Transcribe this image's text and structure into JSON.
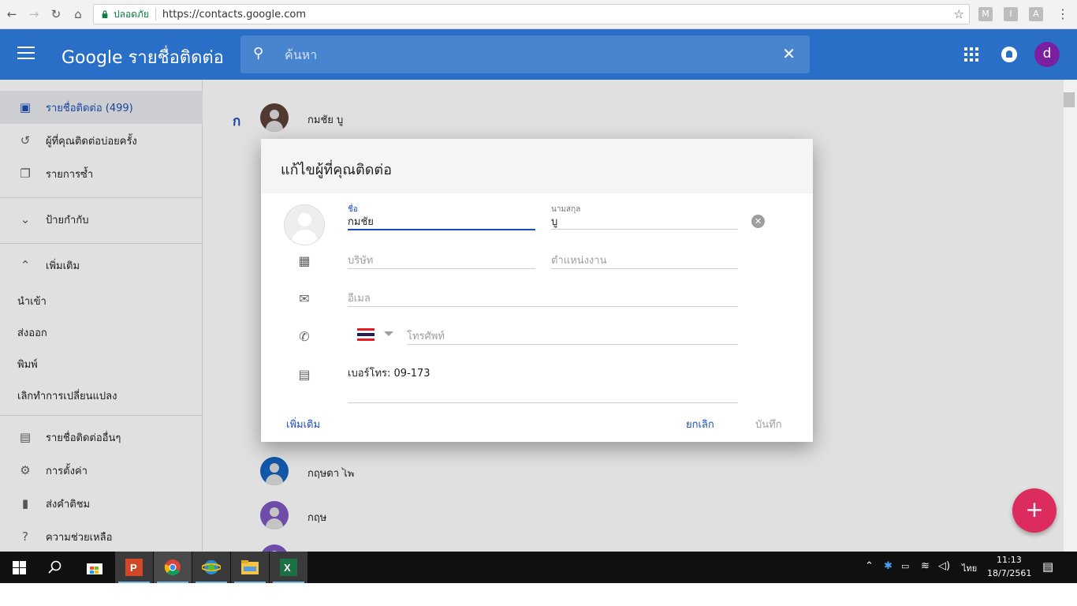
{
  "browser": {
    "secure_label": "ปลอดภัย",
    "url": "https://contacts.google.com",
    "extensions": [
      "M",
      "I",
      "A"
    ]
  },
  "appbar": {
    "title": "Google รายชื่อติดต่อ",
    "search_placeholder": "ค้นหา",
    "account_initial": "d",
    "brand_color": "#2a6fc7"
  },
  "sidebar": {
    "items": [
      {
        "icon": "contacts-icon",
        "label": "รายชื่อติดต่อ (499)",
        "active": true
      },
      {
        "icon": "history-icon",
        "label": "ผู้ที่คุณติดต่อบ่อยครั้ง"
      },
      {
        "icon": "duplicates-icon",
        "label": "รายการซ้ำ"
      },
      {
        "icon": "chevron-down-icon",
        "label": "ป้ายกำกับ"
      },
      {
        "icon": "chevron-up-icon",
        "label": "เพิ่มเติม"
      }
    ],
    "more_links": [
      "นำเข้า",
      "ส่งออก",
      "พิมพ์",
      "เลิกทำการเปลี่ยนแปลง"
    ],
    "bottom_items": [
      {
        "icon": "archive-icon",
        "label": "รายชื่อติดต่ออื่นๆ"
      },
      {
        "icon": "gear-icon",
        "label": "การตั้งค่า"
      },
      {
        "icon": "feedback-icon",
        "label": "ส่งคำติชม"
      },
      {
        "icon": "help-icon",
        "label": "ความช่วยเหลือ"
      }
    ]
  },
  "list": {
    "section_letter": "ก",
    "rows": [
      {
        "name": "กมชัย บู",
        "avatar_color": "#5d4037"
      },
      {
        "name": "กฤษดา ไพ",
        "avatar_color": "#1565c0"
      },
      {
        "name": "กฤษ",
        "avatar_color": "#7e57c2"
      }
    ]
  },
  "dialog": {
    "title": "แก้ไขผู้ที่คุณติดต่อ",
    "first_name_label": "ชื่อ",
    "first_name_value": "กมชัย",
    "last_name_label": "นามสกุล",
    "last_name_value": "บู",
    "company_placeholder": "บริษัท",
    "job_placeholder": "ตำแหน่งงาน",
    "email_placeholder": "อีเมล",
    "phone_placeholder": "โทรศัพท์",
    "notes_value": "เบอร์โทร: 09-173",
    "btn_more": "เพิ่มเติม",
    "btn_cancel": "ยกเลิก",
    "btn_save": "บันทึก"
  },
  "taskbar": {
    "lang": "ไทย",
    "time": "11:13",
    "date": "18/7/2561"
  }
}
